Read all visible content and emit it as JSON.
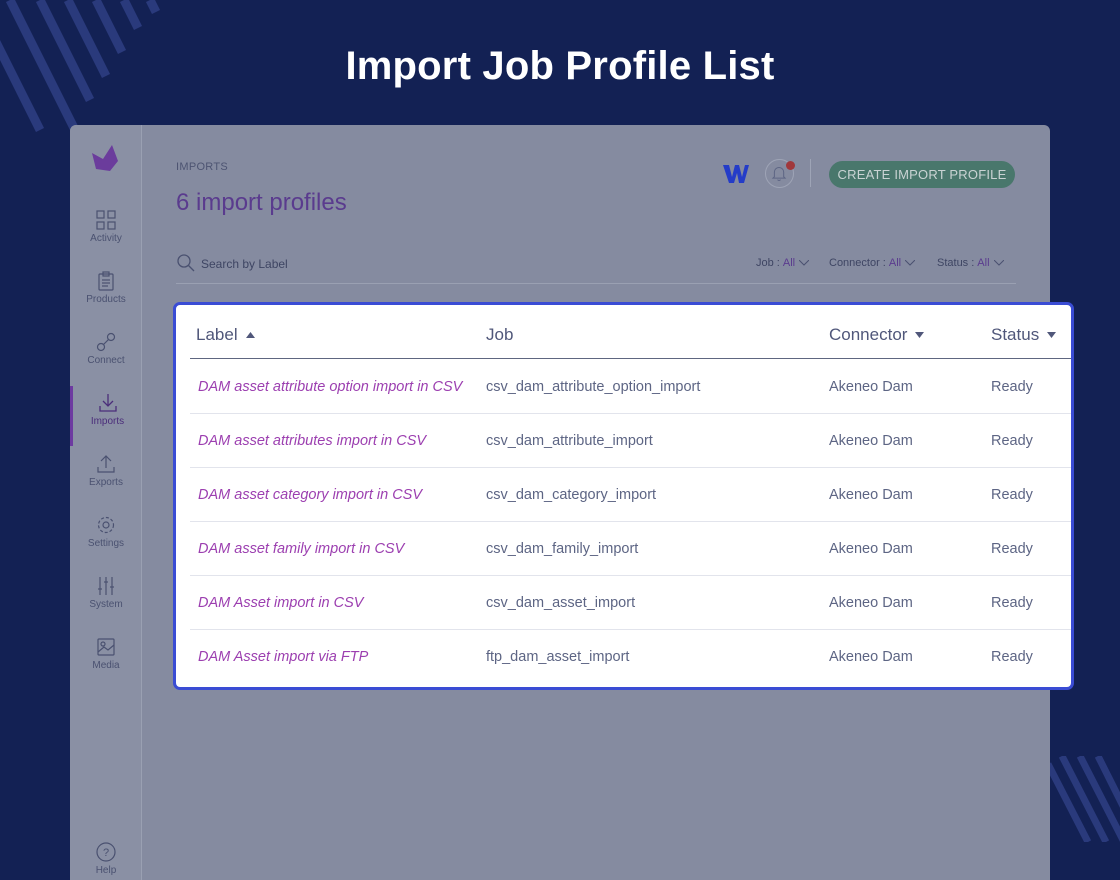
{
  "page_title": "Import Job Profile List",
  "colors": {
    "background": "#132154",
    "accent_purple": "#9c3fb0",
    "highlight_border": "#3a4cd4",
    "create_button": "#49776c"
  },
  "sidebar": {
    "logo_icon": "akeneo-logo-icon",
    "items": [
      {
        "label": "Activity",
        "icon": "activity-grid-icon",
        "active": false
      },
      {
        "label": "Products",
        "icon": "products-clipboard-icon",
        "active": false
      },
      {
        "label": "Connect",
        "icon": "connect-plug-icon",
        "active": false
      },
      {
        "label": "Imports",
        "icon": "import-download-icon",
        "active": true
      },
      {
        "label": "Exports",
        "icon": "export-upload-icon",
        "active": false
      },
      {
        "label": "Settings",
        "icon": "settings-gear-icon",
        "active": false
      },
      {
        "label": "System",
        "icon": "system-sliders-icon",
        "active": false
      },
      {
        "label": "Media",
        "icon": "media-image-icon",
        "active": false
      }
    ],
    "help_label": "Help"
  },
  "header": {
    "breadcrumb": "IMPORTS",
    "title": "6 import profiles",
    "create_button": "CREATE IMPORT PROFILE"
  },
  "search": {
    "placeholder": "Search by Label"
  },
  "filters": [
    {
      "name": "Job :",
      "value": "All"
    },
    {
      "name": "Connector :",
      "value": "All"
    },
    {
      "name": "Status :",
      "value": "All"
    }
  ],
  "table": {
    "columns": [
      "Label",
      "Job",
      "Connector",
      "Status"
    ],
    "rows": [
      {
        "label": "DAM asset attribute option import in CSV",
        "job": "csv_dam_attribute_option_import",
        "connector": "Akeneo Dam",
        "status": "Ready"
      },
      {
        "label": "DAM asset attributes import in CSV",
        "job": "csv_dam_attribute_import",
        "connector": "Akeneo Dam",
        "status": "Ready"
      },
      {
        "label": "DAM asset category import in CSV",
        "job": "csv_dam_category_import",
        "connector": "Akeneo Dam",
        "status": "Ready"
      },
      {
        "label": "DAM asset family import in CSV",
        "job": "csv_dam_family_import",
        "connector": "Akeneo Dam",
        "status": "Ready"
      },
      {
        "label": "DAM Asset import in CSV",
        "job": "csv_dam_asset_import",
        "connector": "Akeneo Dam",
        "status": "Ready"
      },
      {
        "label": "DAM Asset import via FTP",
        "job": "ftp_dam_asset_import",
        "connector": "Akeneo Dam",
        "status": "Ready"
      }
    ]
  }
}
